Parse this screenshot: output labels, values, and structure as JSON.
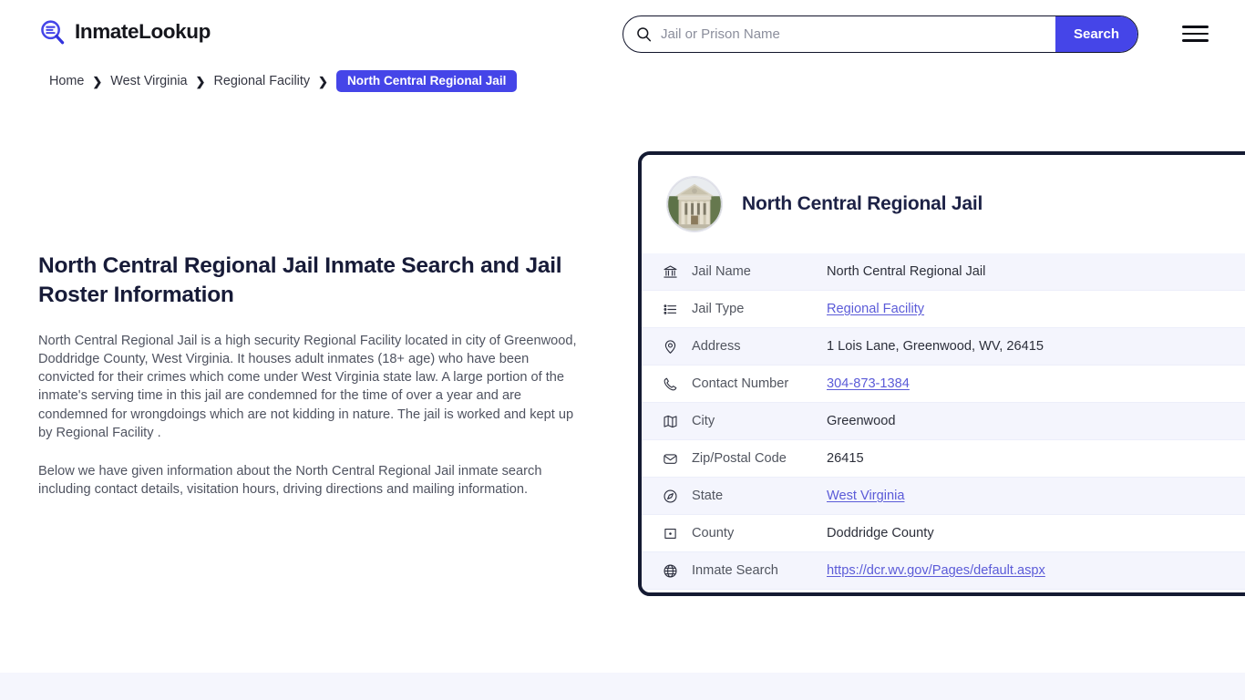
{
  "header": {
    "brand_name": "InmateLookup",
    "brand_icon": "magnifier-list-icon",
    "search": {
      "placeholder": "Jail or Prison Name",
      "value": "",
      "icon": "search-icon",
      "button_label": "Search"
    },
    "menu_icon": "hamburger-menu-icon"
  },
  "breadcrumb": {
    "items": [
      {
        "label": "Home",
        "current": false
      },
      {
        "label": "West Virginia",
        "current": false
      },
      {
        "label": "Regional Facility",
        "current": false
      },
      {
        "label": "North Central Regional Jail",
        "current": true
      }
    ],
    "separator": "❯"
  },
  "main": {
    "title": "North Central Regional Jail Inmate Search and Jail Roster Information",
    "paragraph_1": "North Central Regional Jail is a high security Regional Facility located in city of Greenwood, Doddridge County, West Virginia. It houses adult inmates (18+ age) who have been convicted for their crimes which come under West Virginia state law. A large portion of the inmate's serving time in this jail are condemned for the time of over a year and are condemned for wrongdoings which are not kidding in nature. The jail is worked and kept up by Regional Facility .",
    "paragraph_2": "Below we have given information about the North Central Regional Jail inmate search including contact details, visitation hours, driving directions and mailing information."
  },
  "card": {
    "avatar_icon": "courthouse-photo",
    "title": "North Central Regional Jail",
    "rows": [
      {
        "icon": "bank-icon",
        "label": "Jail Name",
        "value": "North Central Regional Jail",
        "link": false
      },
      {
        "icon": "list-icon",
        "label": "Jail Type",
        "value": "Regional Facility",
        "link": true
      },
      {
        "icon": "map-pin-icon",
        "label": "Address",
        "value": "1 Lois Lane, Greenwood, WV, 26415",
        "link": false
      },
      {
        "icon": "phone-icon",
        "label": "Contact Number",
        "value": "304-873-1384",
        "link": true
      },
      {
        "icon": "map-icon",
        "label": "City",
        "value": "Greenwood",
        "link": false
      },
      {
        "icon": "envelope-icon",
        "label": "Zip/Postal Code",
        "value": "26415",
        "link": false
      },
      {
        "icon": "compass-icon",
        "label": "State",
        "value": "West Virginia",
        "link": true
      },
      {
        "icon": "location-dot-icon",
        "label": "County",
        "value": "Doddridge County",
        "link": false
      },
      {
        "icon": "globe-icon",
        "label": "Inmate Search",
        "value": "https://dcr.wv.gov/Pages/default.aspx",
        "link": true
      }
    ]
  },
  "colors": {
    "accent": "#4545e8",
    "link": "#5b5bd8",
    "card_border": "#141a32",
    "title": "#171b38",
    "row_alt_bg": "#f4f5fd",
    "footer_bg": "#f5f6fd"
  }
}
